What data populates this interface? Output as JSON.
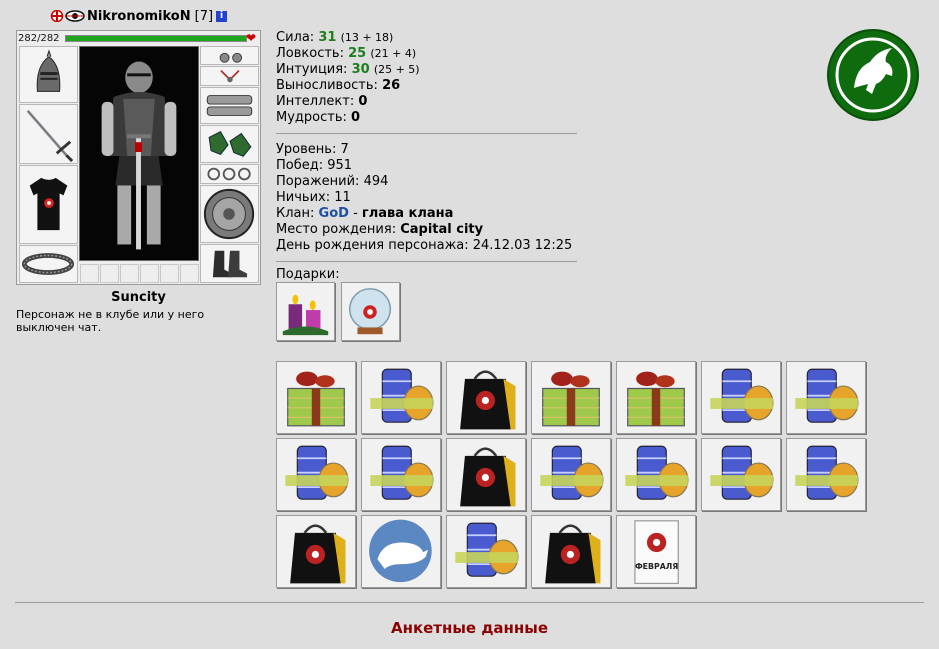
{
  "header": {
    "nickname": "NikronomikoN",
    "level": "[7]",
    "info_label": "i",
    "flag_icon": "flag-icon",
    "clan_icon": "clan-emblem-icon"
  },
  "character": {
    "hp_text": "282/282",
    "hp_fraction": 1.0,
    "hp_color": "#1ea51e",
    "city": "Suncity",
    "status": "Персонаж не в клубе или у него выключен чат."
  },
  "stats": {
    "strength": {
      "label": "Сила:",
      "value": "31",
      "detail": "(13 + 18)"
    },
    "agility": {
      "label": "Ловкость:",
      "value": "25",
      "detail": "(21 + 4)"
    },
    "intuition": {
      "label": "Интуиция:",
      "value": "30",
      "detail": "(25 + 5)"
    },
    "endurance": {
      "label": "Выносливость:",
      "value": "26"
    },
    "intellect": {
      "label": "Интеллект:",
      "value": "0"
    },
    "wisdom": {
      "label": "Мудрость:",
      "value": "0"
    }
  },
  "info": {
    "level": "Уровень: 7",
    "wins": "Побед: 951",
    "losses": "Поражений: 494",
    "draws": "Ничьих: 11",
    "clan_label": "Клан:",
    "clan_name": "GoD",
    "clan_sep": " - ",
    "clan_role": "глава клана",
    "birthplace_label": "Место рождения:",
    "birthplace": "Capital city",
    "birthday": "День рождения персонажа: 24.12.03 12:25"
  },
  "gifts": {
    "label": "Подарки:",
    "top": [
      "candles-gift",
      "snow-globe-gift"
    ],
    "grid": [
      "gift-box",
      "scroll-coins",
      "gift-bag",
      "gift-box",
      "gift-box",
      "scroll-coins",
      "scroll-coins",
      "scroll-coins",
      "scroll-coins",
      "gift-bag",
      "scroll-coins",
      "scroll-coins",
      "scroll-coins",
      "scroll-coins",
      "gift-bag",
      "rat-emblem",
      "scroll-coins",
      "gift-bag",
      "february-card"
    ],
    "card_text": "ФЕВРАЛЯ"
  },
  "colors": {
    "background": "#dedede",
    "emblem_green": "#0e6b0e",
    "link_red": "#8b0000",
    "clan_blue": "#1f4fa3"
  },
  "footer": {
    "link": "Анкетные данные"
  }
}
